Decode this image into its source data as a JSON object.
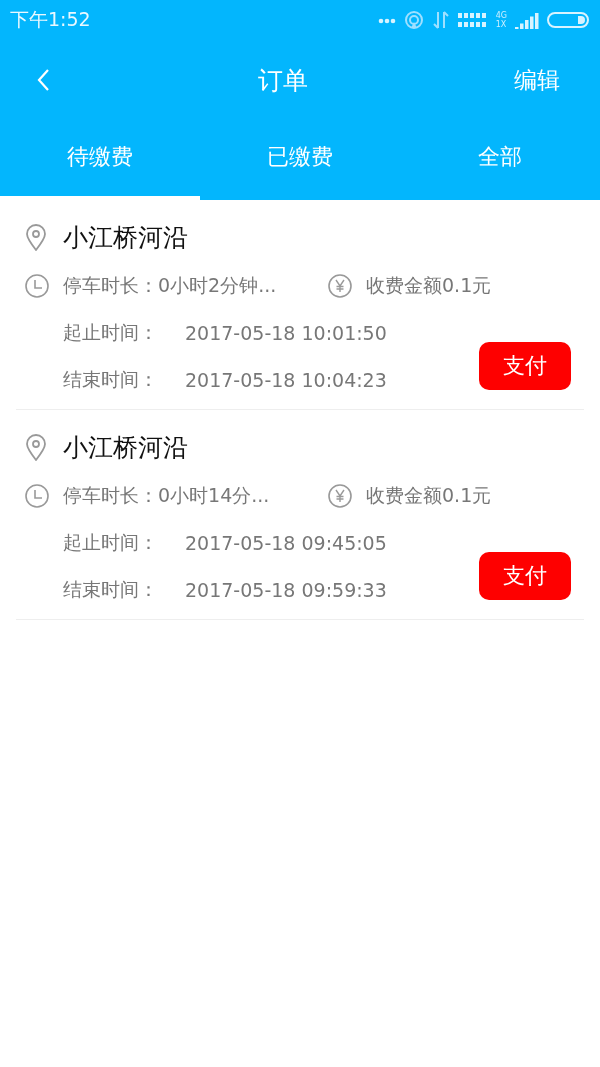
{
  "status_bar": {
    "time": "下午1:52",
    "network_top": "4G",
    "network_bottom": "1X"
  },
  "nav": {
    "title": "订单",
    "action": "编辑"
  },
  "tabs": [
    {
      "label": "待缴费",
      "selected": true
    },
    {
      "label": "已缴费",
      "selected": false
    },
    {
      "label": "全部",
      "selected": false
    }
  ],
  "orders": [
    {
      "location": "小江桥河沿",
      "duration": "停车时长：0小时2分钟...",
      "fee": "收费金额0.1元",
      "start_label": "起止时间：",
      "start": "2017-05-18 10:01:50",
      "end_label": "结束时间：",
      "end": "2017-05-18 10:04:23",
      "button": "支付"
    },
    {
      "location": "小江桥河沿",
      "duration": "停车时长：0小时14分...",
      "fee": "收费金额0.1元",
      "start_label": "起止时间：",
      "start": "2017-05-18 09:45:05",
      "end_label": "结束时间：",
      "end": "2017-05-18 09:59:33",
      "button": "支付"
    }
  ]
}
